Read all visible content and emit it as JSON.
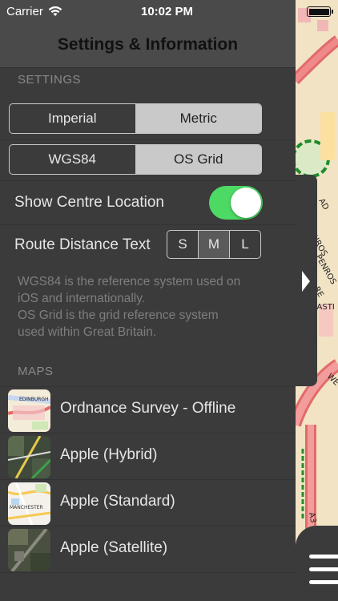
{
  "status_bar": {
    "carrier": "Carrier",
    "time": "10:02 PM"
  },
  "title": "Settings & Information",
  "settings": {
    "header": "SETTINGS",
    "units": {
      "options": [
        "Imperial",
        "Metric"
      ],
      "selected": "Metric"
    },
    "grid": {
      "options": [
        "WGS84",
        "OS Grid"
      ],
      "selected": "OS Grid"
    },
    "show_centre_location": {
      "label": "Show Centre Location",
      "on": true
    },
    "route_distance_text": {
      "label": "Route Distance Text",
      "options": [
        "S",
        "M",
        "L"
      ],
      "selected": "M"
    },
    "note_lines": [
      "WGS84 is the reference system used on",
      "iOS and internationally.",
      "OS Grid is the grid reference system",
      "used within Great Britain."
    ]
  },
  "maps": {
    "header": "MAPS",
    "items": [
      {
        "label": "Ordnance Survey - Offline",
        "thumb": "os-map",
        "thumb_text": "EDINBURGH"
      },
      {
        "label": "Apple (Hybrid)",
        "thumb": "hybrid-map"
      },
      {
        "label": "Apple (Standard)",
        "thumb": "standard-map",
        "thumb_text": "MANCHESTER"
      },
      {
        "label": "Apple (Satellite)",
        "thumb": "satellite-map"
      }
    ]
  },
  "map_background": {
    "labels": [
      "AD",
      "ENROS",
      "PENROS",
      "RE",
      "HASTI",
      "WE",
      "A3"
    ]
  },
  "icons": {
    "wifi": "wifi-icon",
    "battery": "battery-icon",
    "drawer": "chevron-right-icon",
    "menu": "hamburger-menu-icon"
  },
  "colors": {
    "toggle_on": "#4cd964",
    "panel": "#3b3b3b",
    "topbar": "#4a4a4a",
    "segment_selected": "#c9c9c9"
  }
}
